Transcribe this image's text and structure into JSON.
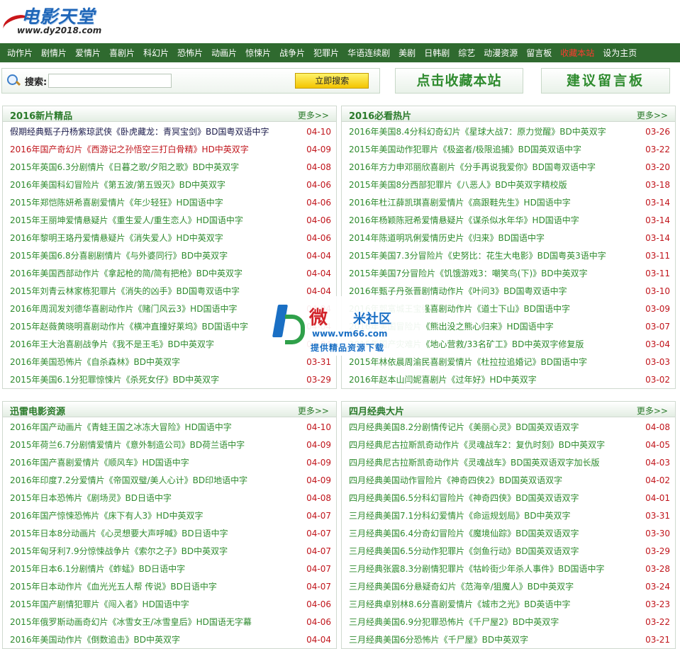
{
  "logo": {
    "title": "电影天堂",
    "url": "www.dy2018.com"
  },
  "nav": [
    {
      "label": "动作片"
    },
    {
      "label": "剧情片"
    },
    {
      "label": "爱情片"
    },
    {
      "label": "喜剧片"
    },
    {
      "label": "科幻片"
    },
    {
      "label": "恐怖片"
    },
    {
      "label": "动画片"
    },
    {
      "label": "惊悚片"
    },
    {
      "label": "战争片"
    },
    {
      "label": "犯罪片"
    },
    {
      "label": "华语连续剧"
    },
    {
      "label": "美剧"
    },
    {
      "label": "日韩剧"
    },
    {
      "label": "综艺"
    },
    {
      "label": "动漫资源"
    },
    {
      "label": "留言板"
    },
    {
      "label": "收藏本站",
      "hot": true
    },
    {
      "label": "设为主页"
    }
  ],
  "search": {
    "label": "搜索:",
    "value": "",
    "button": "立即搜索"
  },
  "buttons": {
    "favorite": "点击收藏本站",
    "guestbook": "建议留言板"
  },
  "more_label": "更多>>",
  "panels": [
    {
      "title": "2016新片精品",
      "items": [
        {
          "text": "假期经典甄子丹杨紫琼武侠《卧虎藏龙：青冥宝剑》BD国粤双语中字",
          "date": "04-10",
          "style": "dark"
        },
        {
          "text": "2016年国产奇幻片《西游记之孙悟空三打白骨精》HD中英双字",
          "date": "04-09",
          "style": "red"
        },
        {
          "text": "2015年英国6.3分剧情片《日暮之歌/夕阳之歌》BD中英双字",
          "date": "04-08"
        },
        {
          "text": "2016年美国科幻冒险片《第五波/第五毁灭》BD中英双字",
          "date": "04-06"
        },
        {
          "text": "2015年郑恺陈妍希喜剧爱情片《年少轻狂》HD国语中字",
          "date": "04-06"
        },
        {
          "text": "2015年王丽坤爱情悬疑片《重生爱人/重生恋人》HD国语中字",
          "date": "04-06"
        },
        {
          "text": "2016年黎明王珞丹爱情悬疑片《消失爱人》HD中英双字",
          "date": "04-06"
        },
        {
          "text": "2015年美国6.8分喜剧剧情片《与外婆同行》BD中英双字",
          "date": "04-04"
        },
        {
          "text": "2016年美国西部动作片《拿起枪的简/简有把枪》BD中英双字",
          "date": "04-04"
        },
        {
          "text": "2015年刘青云林家栋犯罪片《消失的凶手》BD国粤双语中字",
          "date": "04-04"
        },
        {
          "text": "2016年周润发刘德华喜剧动作片《赌门风云3》HD国语中字",
          "date": "04-04"
        },
        {
          "text": "2015年赵薇黄晓明喜剧动作片《横冲直撞好莱坞》BD国语中字",
          "date": "04-04"
        },
        {
          "text": "2016年王大治喜剧战争片《我不是王毛》BD中英双字",
          "date": "04-04"
        },
        {
          "text": "2016年美国恐怖片《自杀森林》BD中英双字",
          "date": "03-31"
        },
        {
          "text": "2015年美国6.1分犯罪惊悚片《杀死女仔》BD中英双字",
          "date": "03-29"
        }
      ]
    },
    {
      "title": "2016必看热片",
      "items": [
        {
          "text": "2016年美国8.4分科幻奇幻片《星球大战7：原力觉醒》BD中英双字",
          "date": "03-26"
        },
        {
          "text": "2015年美国动作犯罪片《极盗者/极限追捕》BD国英双语中字",
          "date": "03-22"
        },
        {
          "text": "2016年方力申邓丽欣喜剧片《分手再说我爱你》BD国粤双语中字",
          "date": "03-20"
        },
        {
          "text": "2015年美国8分西部犯罪片《八恶人》BD中英双字精校版",
          "date": "03-18"
        },
        {
          "text": "2016年杜江薛凯琪喜剧爱情片《高跟鞋先生》HD国语中字",
          "date": "03-14"
        },
        {
          "text": "2016年杨颖陈冠希爱情悬疑片《谋杀似水年华》HD国语中字",
          "date": "03-14"
        },
        {
          "text": "2014年陈道明巩俐爱情历史片《归来》BD国语中字",
          "date": "03-14"
        },
        {
          "text": "2015年美国7.3分冒险片《史努比：花生大电影》BD国粤英3语中字",
          "date": "03-11"
        },
        {
          "text": "2015年美国7分冒险片《饥饿游戏3：嘲笑鸟(下)》BD中英双字",
          "date": "03-11"
        },
        {
          "text": "2016年甄子丹张晋剧情动作片《叶问3》BD国粤双语中字",
          "date": "03-10"
        },
        {
          "text": "2016年郭富城王宝强喜剧动作片《道士下山》BD国语中字",
          "date": "03-09"
        },
        {
          "text": "2016年美国冒险片《熊出没之熊心归来》HD国语中字",
          "date": "03-07"
        },
        {
          "text": "2015年国产灾难片《地心营救/33名矿工》BD中英双字修复版",
          "date": "03-04"
        },
        {
          "text": "2015年林依晨周渝民喜剧爱情片《杜拉拉追婚记》BD国语中字",
          "date": "03-03"
        },
        {
          "text": "2016年赵本山闫妮喜剧片《过年好》HD中英双字",
          "date": "03-02"
        }
      ]
    },
    {
      "title": "迅雷电影资源",
      "items": [
        {
          "text": "2016年国产动画片《青蛙王国之冰冻大冒险》HD国语中字",
          "date": "04-10"
        },
        {
          "text": "2015年荷兰6.7分剧情爱情片《意外制造公司》BD荷兰语中字",
          "date": "04-09"
        },
        {
          "text": "2016年国产喜剧爱情片《顺风车》HD国语中字",
          "date": "04-09"
        },
        {
          "text": "2016年印度7.2分爱情片《帝国双璧/美人心计》BD印地语中字",
          "date": "04-09"
        },
        {
          "text": "2015年日本恐怖片《剧场灵》BD日语中字",
          "date": "04-08"
        },
        {
          "text": "2016年国产惊悚恐怖片《床下有人3》HD中英双字",
          "date": "04-07"
        },
        {
          "text": "2015年日本8分动画片《心灵想要大声呼喊》BD日语中字",
          "date": "04-07"
        },
        {
          "text": "2015年匈牙利7.9分惊悚战争片《索尔之子》BD中英双字",
          "date": "04-07"
        },
        {
          "text": "2015年日本6.1分剧情片《蚱蜢》BD日语中字",
          "date": "04-07"
        },
        {
          "text": "2015年日本动作片《血光光五人帮 传说》BD日语中字",
          "date": "04-07"
        },
        {
          "text": "2015年国产剧情犯罪片《闯入者》HD国语中字",
          "date": "04-06"
        },
        {
          "text": "2015年俄罗斯动画奇幻片《冰雪女王/冰雪皇后》HD国语无字幕",
          "date": "04-06"
        },
        {
          "text": "2016年美国动作片《倒数追击》BD中英双字",
          "date": "04-04"
        }
      ]
    },
    {
      "title": "四月经典大片",
      "items": [
        {
          "text": "四月经典美国8.2分剧情传记片《美丽心灵》BD国英双语双字",
          "date": "04-08"
        },
        {
          "text": "四月经典尼古拉斯凯奇动作片《灵魂战车2：复仇时刻》BD中英双字",
          "date": "04-05"
        },
        {
          "text": "四月经典尼古拉斯凯奇动作片《灵魂战车》BD国英双语双字加长版",
          "date": "04-03"
        },
        {
          "text": "四月经典美国动作冒险片《神奇四侠2》BD国英双语双字",
          "date": "04-02"
        },
        {
          "text": "四月经典美国6.5分科幻冒险片《神奇四侠》BD国英双语双字",
          "date": "04-01"
        },
        {
          "text": "三月经典美国7.1分科幻爱情片《命运规划局》BD中英双字",
          "date": "03-31"
        },
        {
          "text": "三月经典美国6.4分奇幻冒险片《魔境仙踪》BD国英双语双字",
          "date": "03-30"
        },
        {
          "text": "三月经典美国6.5分动作犯罪片《剑鱼行动》BD国英双语双字",
          "date": "03-29"
        },
        {
          "text": "三月经典张震8.3分剧情犯罪片《牯岭街少年杀人事件》BD国语中字",
          "date": "03-28"
        },
        {
          "text": "三月经典美国6分悬疑奇幻片《范海辛/狙魔人》BD中英双字",
          "date": "03-24"
        },
        {
          "text": "三月经典卓别林8.6分喜剧爱情片《城市之光》BD英语中字",
          "date": "03-23"
        },
        {
          "text": "三月经典美国6.9分犯罪恐怖片《千尸屋2》BD中英双字",
          "date": "03-22"
        },
        {
          "text": "三月经典美国6分恐怖片《千尸屋》BD中英双字",
          "date": "03-21"
        }
      ]
    }
  ],
  "watermark": {
    "title": "微",
    "sub": "米社区",
    "url": "www.vm66.com",
    "slogan": "提供精品资源下载"
  },
  "colors": {
    "nav_bg": "#2f6a2f",
    "link": "#2e8b2e",
    "date": "#c0151b",
    "hot": "#ff3b2f"
  }
}
